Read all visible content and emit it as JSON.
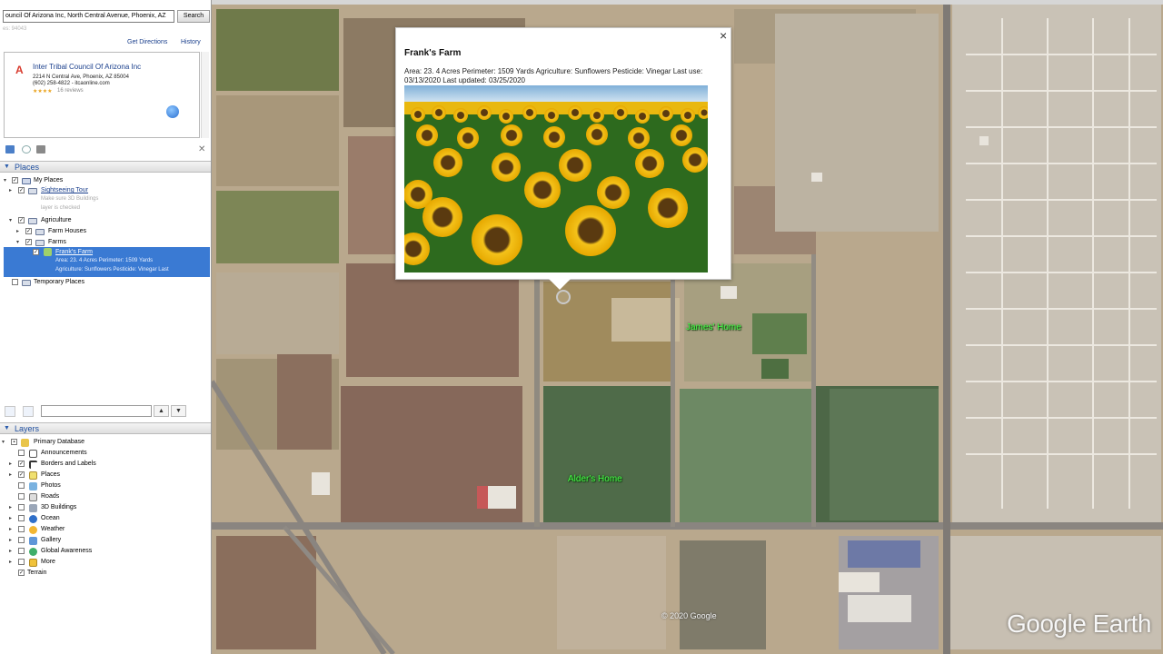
{
  "search": {
    "value": "ouncil Of Arizona Inc, North Central Avenue, Phoenix, AZ",
    "button_label": "Search",
    "hint": "es: 94043",
    "get_directions": "Get Directions",
    "history": "History"
  },
  "result": {
    "pin": "A",
    "title": "Inter Tribal Council Of Arizona Inc",
    "address_line1": "2214 N Central Ave, Phoenix, AZ 85004",
    "address_line2": "(602) 258-4822 - itcaonline.com",
    "stars": "★★★★",
    "reviews": "16 reviews"
  },
  "places": {
    "header": "Places",
    "my_places": "My Places",
    "sightseeing_tour": "Sightseeing Tour",
    "sightseeing_note1": "Make sure 3D Buildings",
    "sightseeing_note2": "layer is checked",
    "agriculture": "Agriculture",
    "farm_houses": "Farm Houses",
    "farms": "Farms",
    "franks_farm": "Frank's Farm",
    "franks_farm_line1": "Area: 23. 4 Acres Perimeter: 1509 Yards",
    "franks_farm_line2": "Agriculture: Sunflowers Pesticide: Vinegar Last",
    "temporary_places": "Temporary Places"
  },
  "layers": {
    "header": "Layers",
    "items": [
      "Primary Database",
      "Announcements",
      "Borders and Labels",
      "Places",
      "Photos",
      "Roads",
      "3D Buildings",
      "Ocean",
      "Weather",
      "Gallery",
      "Global Awareness",
      "More",
      "Terrain"
    ]
  },
  "balloon": {
    "title": "Frank's Farm",
    "description": "Area: 23. 4 Acres Perimeter: 1509 Yards Agriculture: Sunflowers Pesticide: Vinegar Last use: 03/13/2020 Last updated: 03/25/2020",
    "close": "×"
  },
  "map": {
    "placemarks": [
      "James' Home",
      "Alder's Home"
    ],
    "copyright": "© 2020 Google",
    "logo": "Google Earth"
  }
}
